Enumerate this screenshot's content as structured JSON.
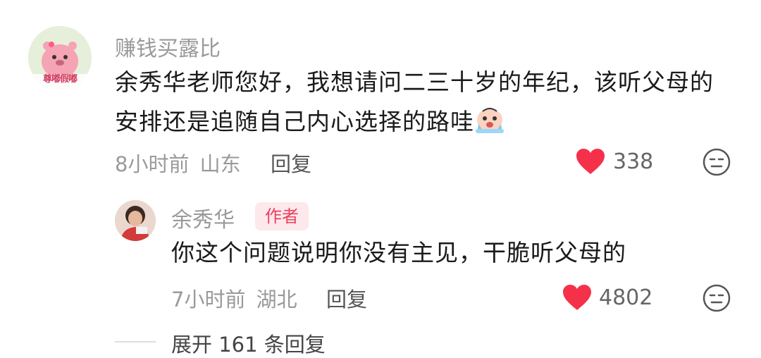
{
  "comment": {
    "avatar_text": "尊嘟假嘟",
    "username": "赚钱买露比",
    "line1": "余秀华老师您好，我想请问二三十岁的年纪，该听父母的",
    "line2": "安排还是追随自己内心选择的路哇",
    "time": "8小时前",
    "location": "山东",
    "reply_label": "回复",
    "likes": "338"
  },
  "reply": {
    "username": "余秀华",
    "badge": "作者",
    "content": "你这个问题说明你没有主见，干脆听父母的",
    "time": "7小时前",
    "location": "湖北",
    "reply_label": "回复",
    "likes": "4802"
  },
  "expand_label": "展开 161 条回复",
  "colors": {
    "heart": "#f5314a",
    "badge_bg": "#fde8ec",
    "badge_text": "#e8435d",
    "muted": "#9a9a9a"
  }
}
